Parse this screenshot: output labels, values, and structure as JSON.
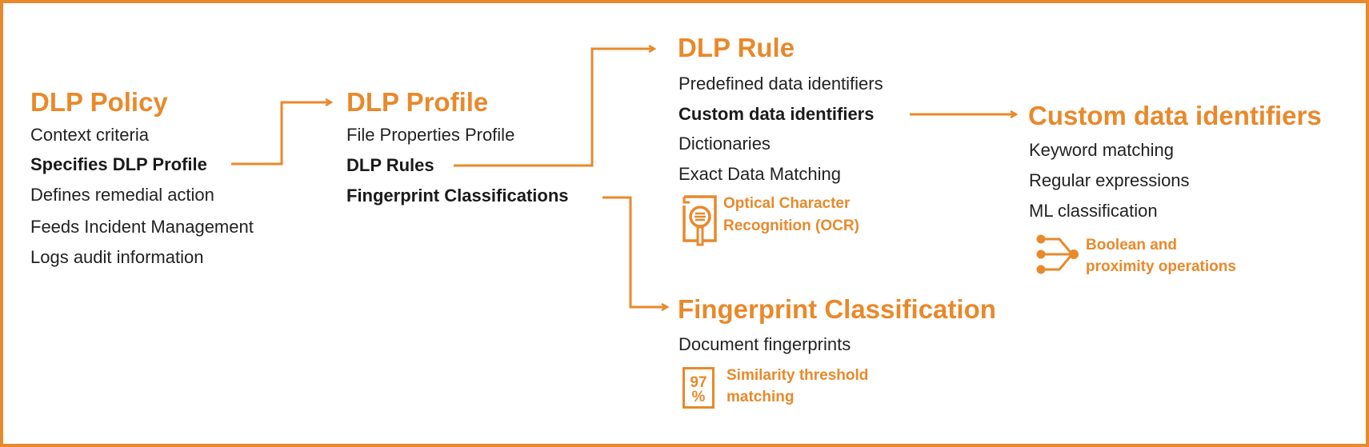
{
  "accent_color": "#E8892B",
  "policy": {
    "title": "DLP Policy",
    "items": [
      "Context criteria",
      "Specifies DLP Profile",
      "Defines remedial action",
      "Feeds Incident Management",
      "Logs audit information"
    ]
  },
  "profile": {
    "title": "DLP Profile",
    "items": [
      "File Properties Profile",
      "DLP Rules",
      "Fingerprint Classifications"
    ]
  },
  "rule": {
    "title": "DLP Rule",
    "items": [
      "Predefined data identifiers",
      "Custom data identifiers",
      "Dictionaries",
      "Exact Data Matching"
    ],
    "ocr": {
      "icon": "document-magnifier-icon",
      "line1": "Optical Character",
      "line2": "Recognition (OCR)"
    }
  },
  "custom": {
    "title": "Custom data identifiers",
    "items": [
      "Keyword matching",
      "Regular expressions",
      "ML classification"
    ],
    "boolean": {
      "icon": "merge-nodes-icon",
      "line1": "Boolean and",
      "line2": "proximity operations"
    }
  },
  "fingerprint": {
    "title": "Fingerprint Classification",
    "items": [
      "Document fingerprints"
    ],
    "similarity": {
      "icon": "percent-document-icon",
      "icon_top": "97",
      "icon_bottom": "%",
      "line1": "Similarity threshold",
      "line2": "matching"
    }
  }
}
